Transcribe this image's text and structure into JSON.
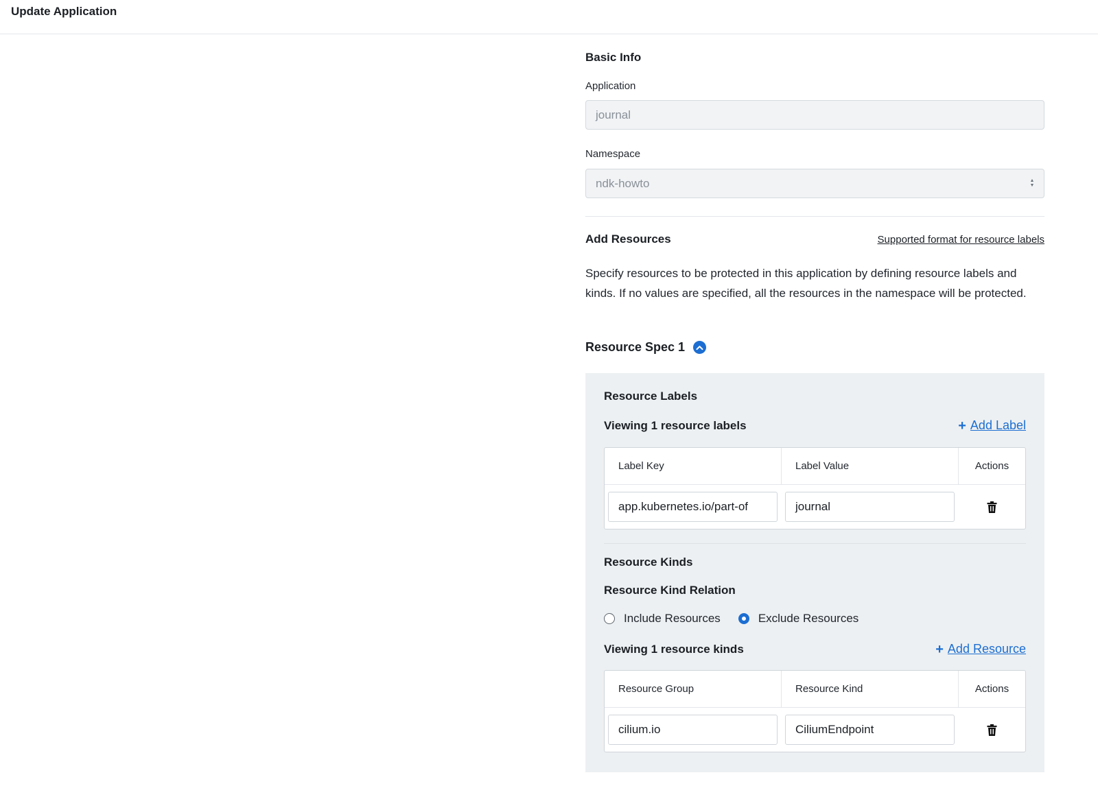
{
  "header": {
    "title": "Update Application"
  },
  "basic_info": {
    "title": "Basic Info",
    "application_label": "Application",
    "application_value": "journal",
    "namespace_label": "Namespace",
    "namespace_value": "ndk-howto"
  },
  "add_resources": {
    "title": "Add Resources",
    "format_link": "Supported format for resource labels",
    "description": "Specify resources to be protected in this application by defining resource labels and kinds. If no values are specified, all the resources in the namespace will be protected."
  },
  "resource_spec": {
    "title": "Resource Spec 1",
    "labels": {
      "title": "Resource Labels",
      "viewing": "Viewing 1 resource labels",
      "add_label": "Add Label",
      "columns": [
        "Label Key",
        "Label Value",
        "Actions"
      ],
      "rows": [
        {
          "key": "app.kubernetes.io/part-of",
          "value": "journal"
        }
      ]
    },
    "kinds": {
      "title": "Resource Kinds",
      "relation_title": "Resource Kind Relation",
      "options": [
        {
          "label": "Include Resources",
          "selected": false
        },
        {
          "label": "Exclude Resources",
          "selected": true
        }
      ],
      "viewing": "Viewing 1 resource kinds",
      "add_resource": "Add Resource",
      "columns": [
        "Resource Group",
        "Resource Kind",
        "Actions"
      ],
      "rows": [
        {
          "group": "cilium.io",
          "kind": "CiliumEndpoint"
        }
      ]
    }
  },
  "colors": {
    "accent": "#1c6ed2",
    "panel_bg": "#edf0f2",
    "disabled_bg": "#f1f3f5"
  },
  "icons": {
    "chevron": "chevron-up-icon",
    "delete": "trash-icon",
    "add": "plus-icon",
    "select": "select-arrows-icon"
  }
}
